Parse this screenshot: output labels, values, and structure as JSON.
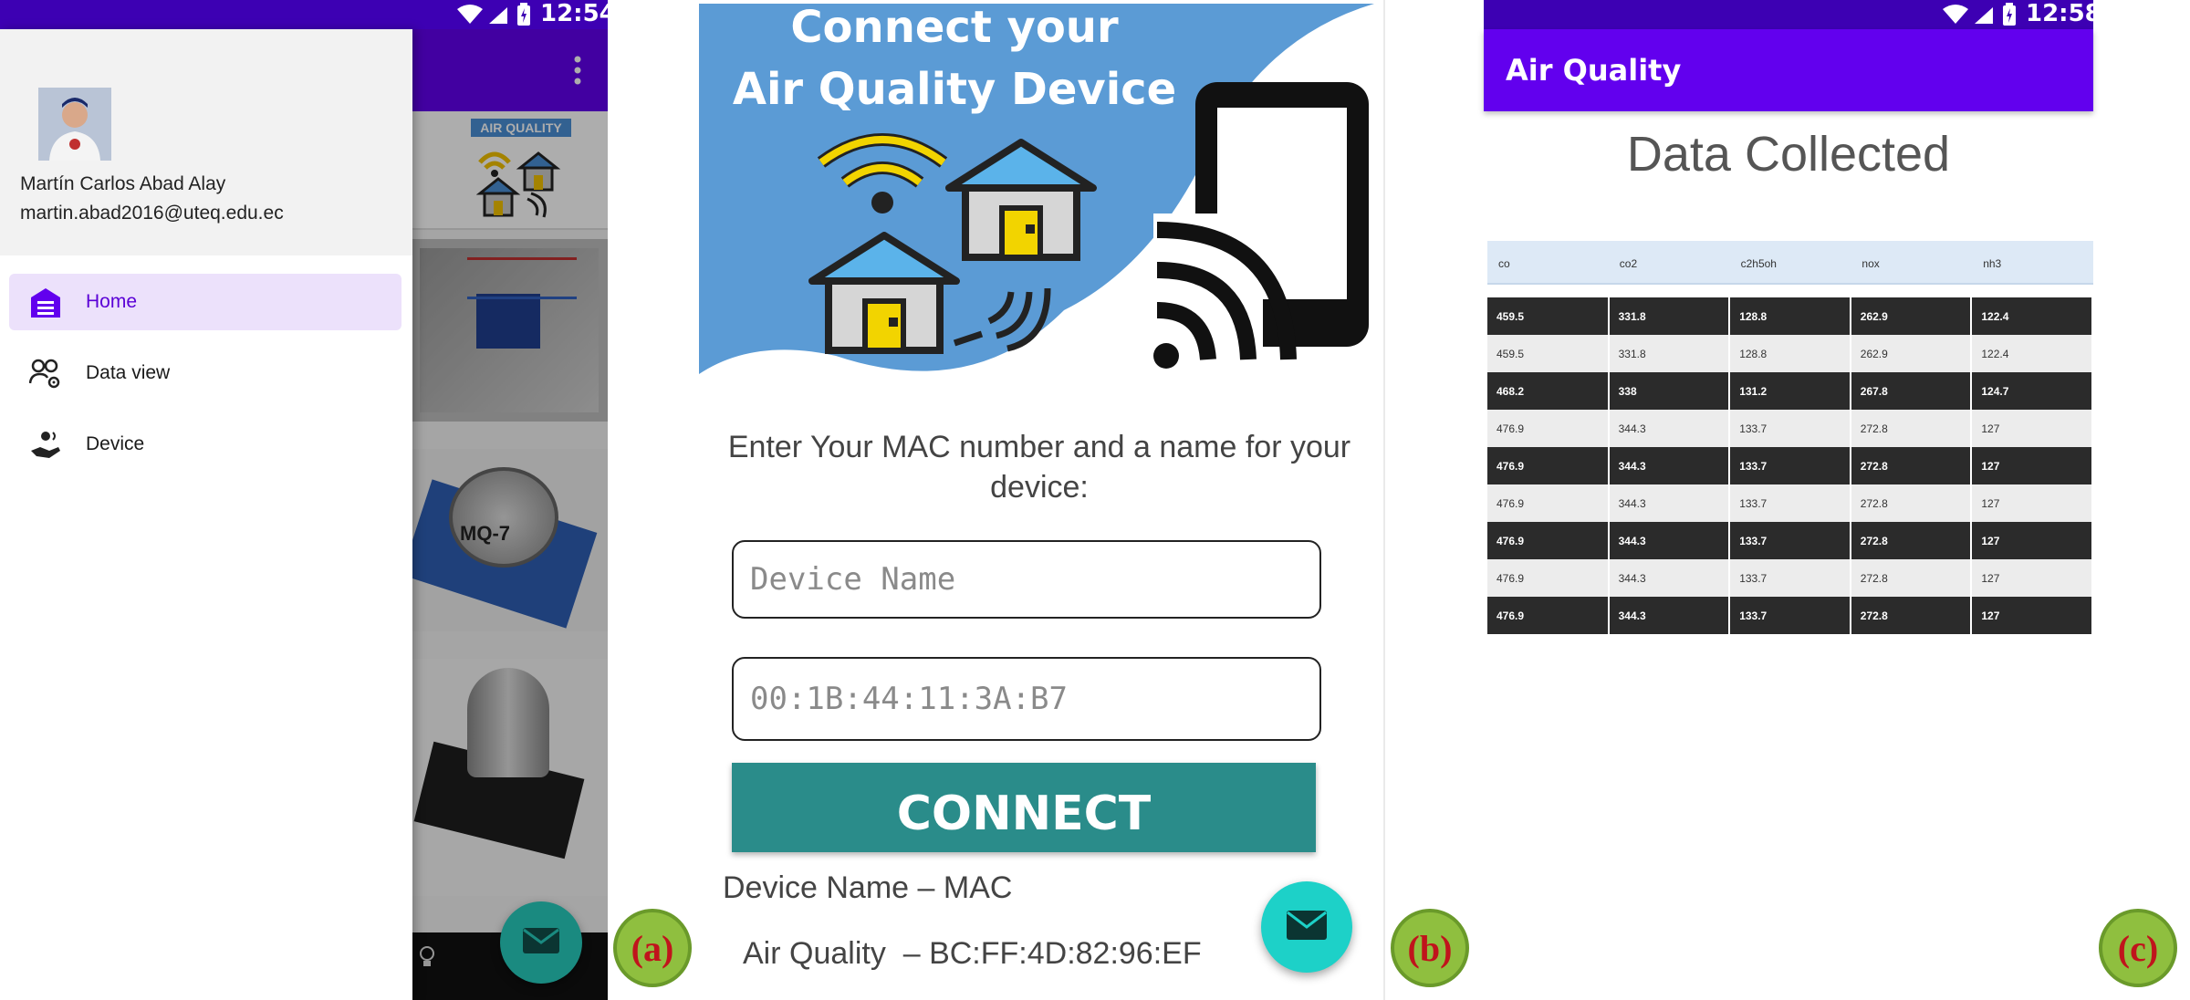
{
  "panel_a": {
    "status_time": "12:54",
    "user_name": "Martín Carlos Abad Alay",
    "user_email": "martin.abad2016@uteq.edu.ec",
    "menu": [
      {
        "label": "Home",
        "icon": "home-icon",
        "active": true
      },
      {
        "label": "Data view",
        "icon": "people-settings-icon",
        "active": false
      },
      {
        "label": "Device",
        "icon": "device-hand-icon",
        "active": false
      }
    ],
    "banner_text": "AIR QUALITY",
    "sensor_label": "MQ-7",
    "badge": "(a)",
    "colors": {
      "accent": "#6200ee",
      "status_bar": "#3d00b3",
      "fab": "#1a8a80"
    }
  },
  "panel_b": {
    "hero_title_line1": "Connect your",
    "hero_title_line2": "Air Quality Device",
    "instructions": "Enter Your MAC number and a name for your device:",
    "device_name_placeholder": "Device Name",
    "mac_placeholder": "00:1B:44:11:3A:B7",
    "connect_label": "CONNECT",
    "list_header": "Device Name – MAC",
    "list_item": "Air Quality  – BC:FF:4D:82:96:EF",
    "badge": "(b)",
    "colors": {
      "hero": "#5b9bd5",
      "button": "#2a8c8a",
      "fab": "#1dd1c8"
    }
  },
  "panel_c": {
    "status_time": "12:58",
    "app_title": "Air Quality",
    "heading": "Data Collected",
    "columns": [
      "co",
      "co2",
      "c2h5oh",
      "nox",
      "nh3"
    ],
    "rows": [
      [
        "459.5",
        "331.8",
        "128.8",
        "262.9",
        "122.4"
      ],
      [
        "459.5",
        "331.8",
        "128.8",
        "262.9",
        "122.4"
      ],
      [
        "468.2",
        "338",
        "131.2",
        "267.8",
        "124.7"
      ],
      [
        "476.9",
        "344.3",
        "133.7",
        "272.8",
        "127"
      ],
      [
        "476.9",
        "344.3",
        "133.7",
        "272.8",
        "127"
      ],
      [
        "476.9",
        "344.3",
        "133.7",
        "272.8",
        "127"
      ],
      [
        "476.9",
        "344.3",
        "133.7",
        "272.8",
        "127"
      ],
      [
        "476.9",
        "344.3",
        "133.7",
        "272.8",
        "127"
      ],
      [
        "476.9",
        "344.3",
        "133.7",
        "272.8",
        "127"
      ]
    ],
    "badge": "(c)",
    "colors": {
      "app_bar": "#6200ee",
      "status_bar": "#3d00b3"
    }
  }
}
